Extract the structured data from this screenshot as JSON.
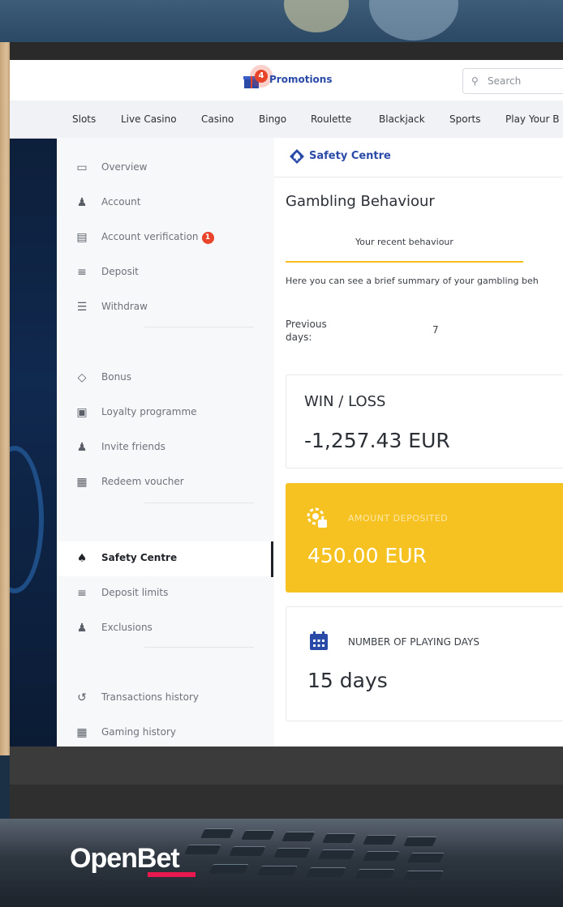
{
  "header": {
    "promotions_label": "Promotions",
    "promotions_count": "4",
    "search_placeholder": "Search"
  },
  "categories": [
    "Slots",
    "Live Casino",
    "Casino",
    "Bingo",
    "Roulette",
    "Blackjack",
    "Sports",
    "Play Your B"
  ],
  "sidebar": {
    "items": [
      {
        "label": "Overview",
        "icon": "monitor-icon"
      },
      {
        "label": "Account",
        "icon": "user-icon"
      },
      {
        "label": "Account verification",
        "icon": "id-card-icon",
        "badge": "1"
      },
      {
        "label": "Deposit",
        "icon": "deposit-icon"
      },
      {
        "label": "Withdraw",
        "icon": "withdraw-icon"
      },
      {
        "label": "Bonus",
        "icon": "diamond-icon"
      },
      {
        "label": "Loyalty programme",
        "icon": "loyalty-card-icon"
      },
      {
        "label": "Invite friends",
        "icon": "add-user-icon"
      },
      {
        "label": "Redeem voucher",
        "icon": "gift-icon"
      },
      {
        "label": "Safety Centre",
        "icon": "spade-icon",
        "active": true
      },
      {
        "label": "Deposit limits",
        "icon": "limit-icon"
      },
      {
        "label": "Exclusions",
        "icon": "exclude-user-icon"
      },
      {
        "label": "Transactions history",
        "icon": "history-icon"
      },
      {
        "label": "Gaming history",
        "icon": "gaming-history-icon"
      }
    ]
  },
  "safety_centre": {
    "title": "Safety Centre",
    "section_title": "Gambling Behaviour",
    "tab_label": "Your recent behaviour",
    "summary_text": "Here you can see a brief summary of your gambling beh",
    "previous_days_label": "Previous days:",
    "previous_days_value": "7",
    "win_loss": {
      "label": "WIN / LOSS",
      "value": "-1,257.43 EUR"
    },
    "amount_deposited": {
      "label": "AMOUNT DEPOSITED",
      "value": "450.00 EUR"
    },
    "playing_days": {
      "label": "NUMBER OF PLAYING DAYS",
      "value": "15 days"
    }
  },
  "brand": {
    "name": "OpenBet"
  },
  "colors": {
    "accent_yellow": "#f6c221",
    "link_blue": "#2a4aa8",
    "badge_red": "#e8442a",
    "brand_pink": "#e8194f"
  }
}
